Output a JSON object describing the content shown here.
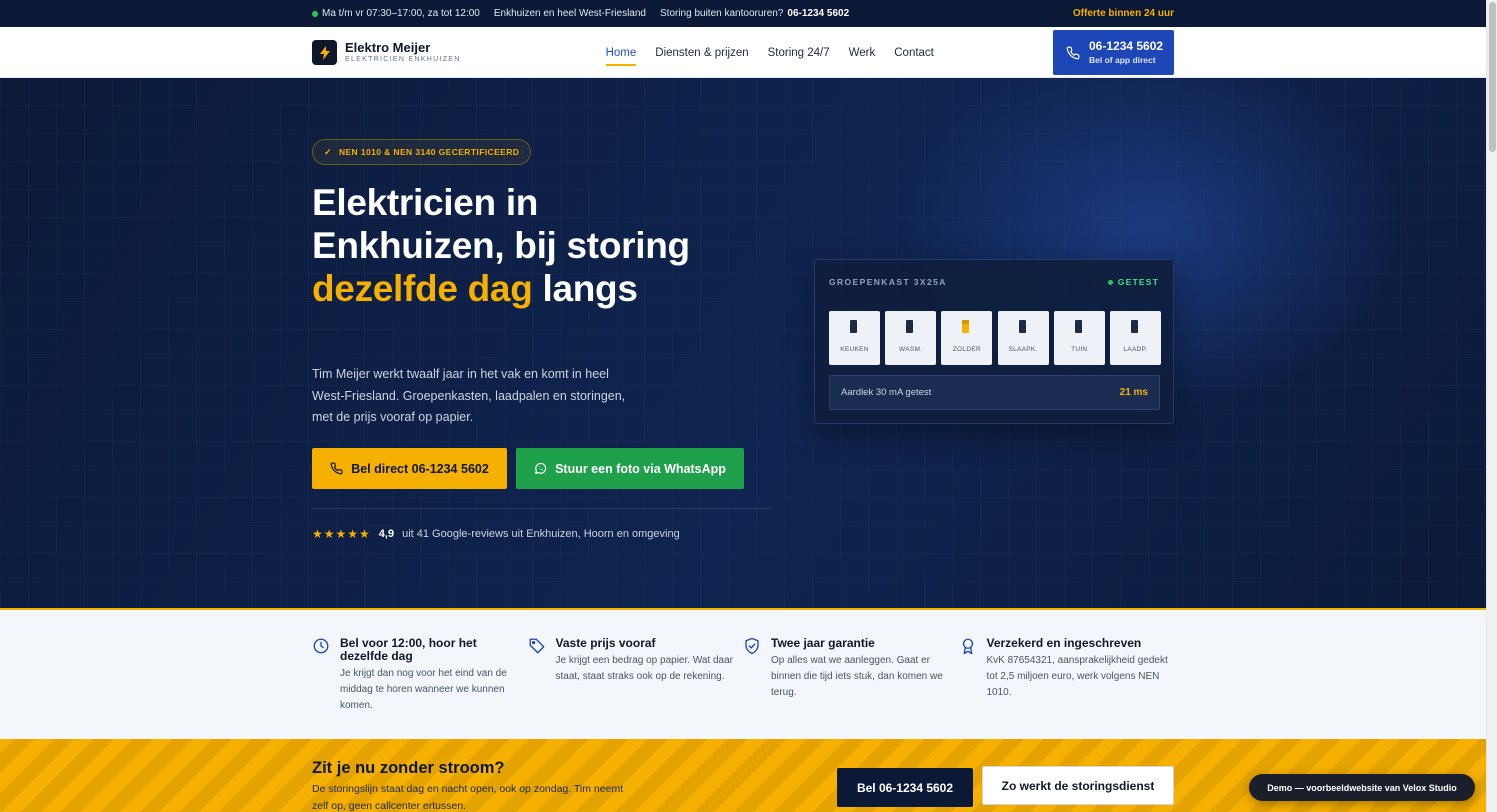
{
  "topbar": {
    "hours": "Ma t/m vr 07:30–17:00, za tot 12:00",
    "region": "Enkhuizen en heel West-Friesland",
    "after_hours_label": "Storing buiten kantooruren?",
    "after_hours_phone": "06-1234 5602",
    "offer": "Offerte binnen 24 uur"
  },
  "header": {
    "logo_title": "Elektro Meijer",
    "logo_sub": "ELEKTRICIEN ENKHUIZEN",
    "nav": [
      {
        "label": "Home",
        "active": true
      },
      {
        "label": "Diensten & prijzen"
      },
      {
        "label": "Storing 24/7"
      },
      {
        "label": "Werk"
      },
      {
        "label": "Contact"
      }
    ],
    "cta_phone": "06-1234 5602",
    "cta_sub": "Bel of app direct"
  },
  "hero": {
    "badge": "NEN 1010 & NEN 3140 GECERTIFICEERD",
    "h1_part1": "Elektricien in Enkhuizen, bij storing ",
    "h1_accent": "dezelfde dag",
    "h1_part2": " langs",
    "lead": "Tim Meijer werkt twaalf jaar in het vak en komt in heel West-Friesland. Groepenkasten, laadpalen en storingen, met de prijs vooraf op papier.",
    "btn_call": "Bel direct 06-1234 5602",
    "btn_whatsapp": "Stuur een foto via WhatsApp",
    "stars": "★★★★★",
    "rating_score": "4,9",
    "rating_text": "uit 41 Google-reviews uit Enkhuizen, Hoorn en omgeving"
  },
  "panel": {
    "title": "GROEPENKAST 3X25A",
    "status": "GETEST",
    "groups": [
      {
        "label": "KEUKEN",
        "on": false
      },
      {
        "label": "WASM.",
        "on": false
      },
      {
        "label": "ZOLDER",
        "on": true
      },
      {
        "label": "SLAAPK.",
        "on": false
      },
      {
        "label": "TUIN",
        "on": false
      },
      {
        "label": "LAADP.",
        "on": false
      }
    ],
    "foot_label": "Aardlek 30 mA getest",
    "foot_value": "21 ms"
  },
  "features": [
    {
      "icon": "clock-icon",
      "title": "Bel voor 12:00, hoor het dezelfde dag",
      "desc": "Je krijgt dan nog voor het eind van de middag te horen wanneer we kunnen komen."
    },
    {
      "icon": "tag-icon",
      "title": "Vaste prijs vooraf",
      "desc": "Je krijgt een bedrag op papier. Wat daar staat, staat straks ook op de rekening."
    },
    {
      "icon": "shield-check-icon",
      "title": "Twee jaar garantie",
      "desc": "Op alles wat we aanleggen. Gaat er binnen die tijd iets stuk, dan komen we terug."
    },
    {
      "icon": "award-icon",
      "title": "Verzekerd en ingeschreven",
      "desc": "KvK 87654321, aansprakelijkheid gedekt tot 2,5 miljoen euro, werk volgens NEN 1010."
    }
  ],
  "outage": {
    "title": "Zit je nu zonder stroom?",
    "text": "De storingslijn staat dag en nacht open, ook op zondag. Tim neemt zelf op, geen callcenter ertussen.",
    "btn_call": "Bel 06-1234 5602",
    "btn_info": "Zo werkt de storingsdienst"
  },
  "demo": "Demo — voorbeeldwebsite van Velox Studio",
  "colors": {
    "accent": "#f5b000",
    "brand_blue": "#1d46b6",
    "navy": "#0b1836",
    "whatsapp": "#1fa14b"
  }
}
